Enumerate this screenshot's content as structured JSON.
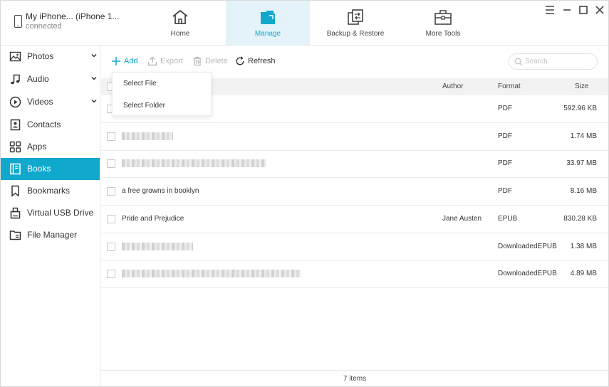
{
  "device": {
    "name": "My iPhone... (iPhone 1...",
    "status": "connected"
  },
  "nav_tabs": [
    {
      "label": "Home",
      "icon": "home-icon"
    },
    {
      "label": "Manage",
      "icon": "folder-icon",
      "active": true
    },
    {
      "label": "Backup & Restore",
      "icon": "backup-restore-icon"
    },
    {
      "label": "More Tools",
      "icon": "toolbox-icon"
    }
  ],
  "window_controls": {
    "menu": "menu-icon",
    "minimize": "minimize-icon",
    "maximize": "maximize-icon",
    "close": "close-icon"
  },
  "sidebar": {
    "items": [
      {
        "label": "Photos",
        "icon": "photo-icon",
        "expandable": true
      },
      {
        "label": "Audio",
        "icon": "music-note-icon",
        "expandable": true
      },
      {
        "label": "Videos",
        "icon": "play-circle-icon",
        "expandable": true
      },
      {
        "label": "Contacts",
        "icon": "contact-icon"
      },
      {
        "label": "Apps",
        "icon": "apps-grid-icon"
      },
      {
        "label": "Books",
        "icon": "book-icon",
        "active": true
      },
      {
        "label": "Bookmarks",
        "icon": "bookmark-icon"
      },
      {
        "label": "Virtual USB Drive",
        "icon": "usb-drive-icon"
      },
      {
        "label": "File Manager",
        "icon": "file-manager-icon"
      }
    ]
  },
  "toolbar": {
    "add_label": "Add",
    "export_label": "Export",
    "delete_label": "Delete",
    "refresh_label": "Refresh",
    "search_placeholder": "Search"
  },
  "add_menu": {
    "items": [
      "Select File",
      "Select Folder"
    ]
  },
  "table": {
    "columns": {
      "author": "Author",
      "format": "Format",
      "size": "Size"
    },
    "rows": [
      {
        "name": "",
        "author": "",
        "format": "PDF",
        "size": "592.96 KB",
        "blurred": false
      },
      {
        "name": "",
        "author": "",
        "format": "PDF",
        "size": "1.74 MB",
        "blurred": true,
        "blur_width": 72
      },
      {
        "name": "",
        "author": "",
        "format": "PDF",
        "size": "33.97 MB",
        "blurred": true,
        "blur_width": 202
      },
      {
        "name": "a free growns in booklyn",
        "author": "",
        "format": "PDF",
        "size": "8.16 MB",
        "blurred": false
      },
      {
        "name": "Pride and Prejudice",
        "author": "Jane Austen",
        "format": "EPUB",
        "size": "830.28 KB",
        "blurred": false
      },
      {
        "name": "",
        "author": "",
        "format": "DownloadedEPUB",
        "size": "1.38 MB",
        "blurred": true,
        "blur_width": 100
      },
      {
        "name": "",
        "author": "",
        "format": "DownloadedEPUB",
        "size": "4.89 MB",
        "blurred": true,
        "blur_width": 252
      }
    ]
  },
  "status": {
    "count_text": "7 items"
  },
  "colors": {
    "accent": "#11a8cd",
    "active_tab_bg": "#e3f3f9"
  }
}
